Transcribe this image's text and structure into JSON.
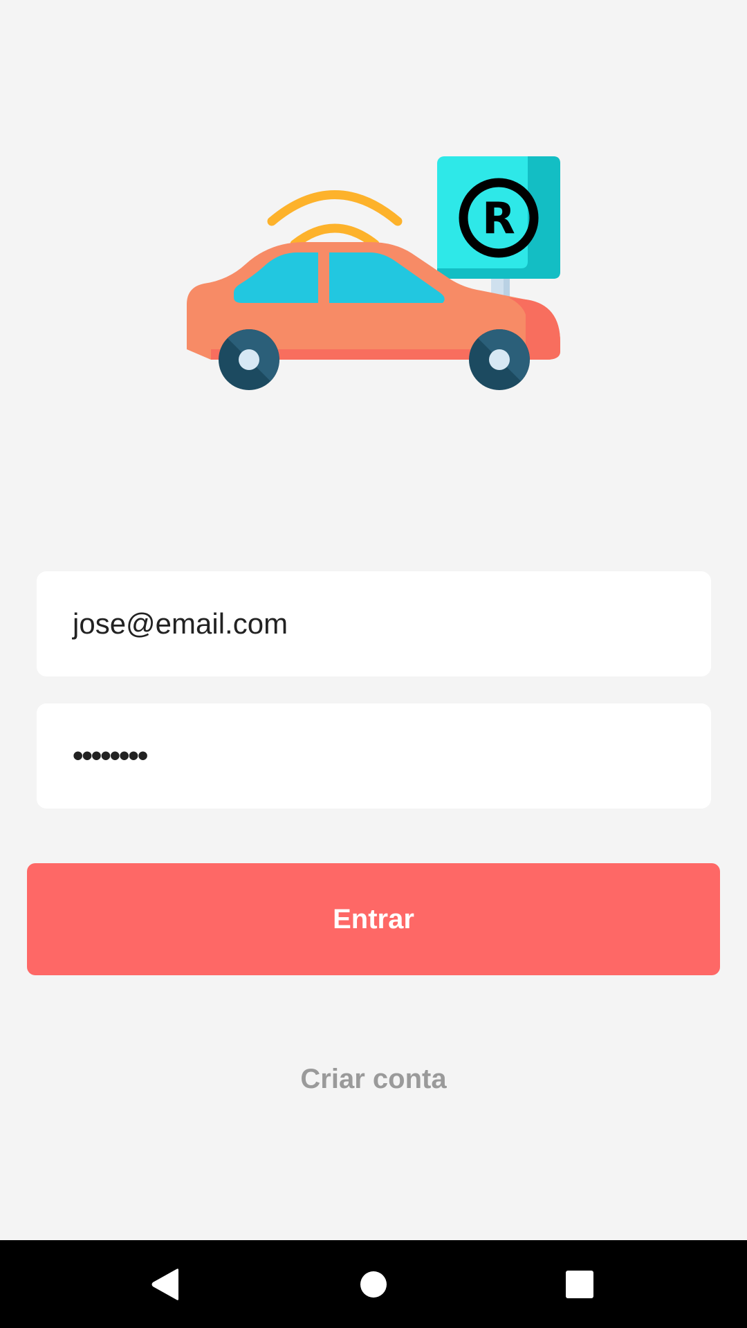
{
  "login": {
    "email_value": "jose@email.com",
    "password_value": "••••••••",
    "submit_label": "Entrar",
    "create_account_label": "Criar conta"
  },
  "illustration": {
    "name": "car-parking-wifi-illustration",
    "sign_letter": "R"
  },
  "nav": {
    "back_icon": "back-triangle-icon",
    "home_icon": "home-circle-icon",
    "recents_icon": "recents-square-icon"
  },
  "colors": {
    "background": "#f4f4f4",
    "primary": "#fe6866",
    "link": "#9a9a9a",
    "car_body": "#f78b66",
    "car_window": "#22c7e0",
    "wifi": "#fdb22b",
    "sign": "#2ee8e8"
  }
}
